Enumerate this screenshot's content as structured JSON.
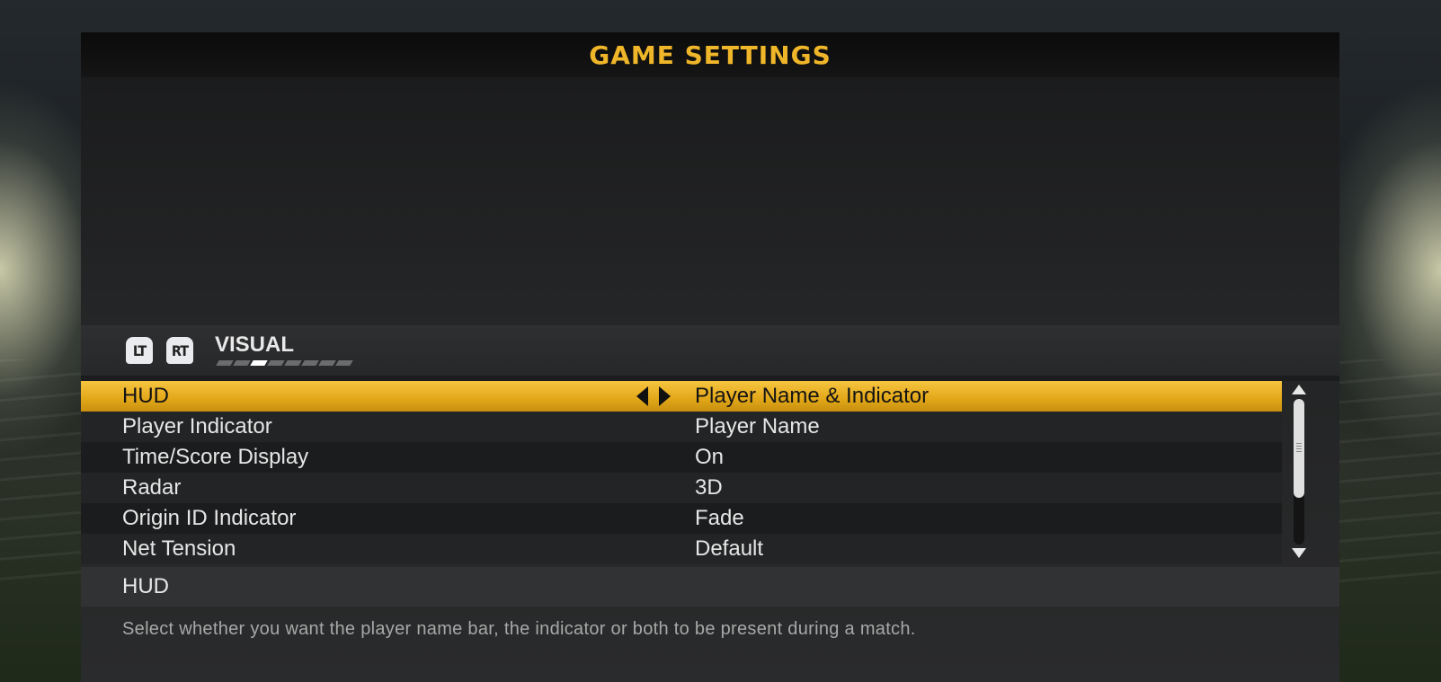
{
  "header": {
    "title": "GAME SETTINGS"
  },
  "category": {
    "lt_label": "LT",
    "rt_label": "RT",
    "name": "VISUAL",
    "page_count": 8,
    "active_page": 2
  },
  "settings": [
    {
      "name": "HUD",
      "value": "Player Name & Indicator",
      "selected": true
    },
    {
      "name": "Player Indicator",
      "value": "Player Name",
      "selected": false
    },
    {
      "name": "Time/Score Display",
      "value": "On",
      "selected": false
    },
    {
      "name": "Radar",
      "value": "3D",
      "selected": false
    },
    {
      "name": "Origin ID Indicator",
      "value": "Fade",
      "selected": false
    },
    {
      "name": "Net Tension",
      "value": "Default",
      "selected": false
    }
  ],
  "help": {
    "title": "HUD",
    "description": "Select whether you want the player name bar, the indicator or both to be present during a match."
  },
  "colors": {
    "accent": "#f0b62a",
    "selected_row": "#e2a718",
    "panel": "#222324"
  }
}
